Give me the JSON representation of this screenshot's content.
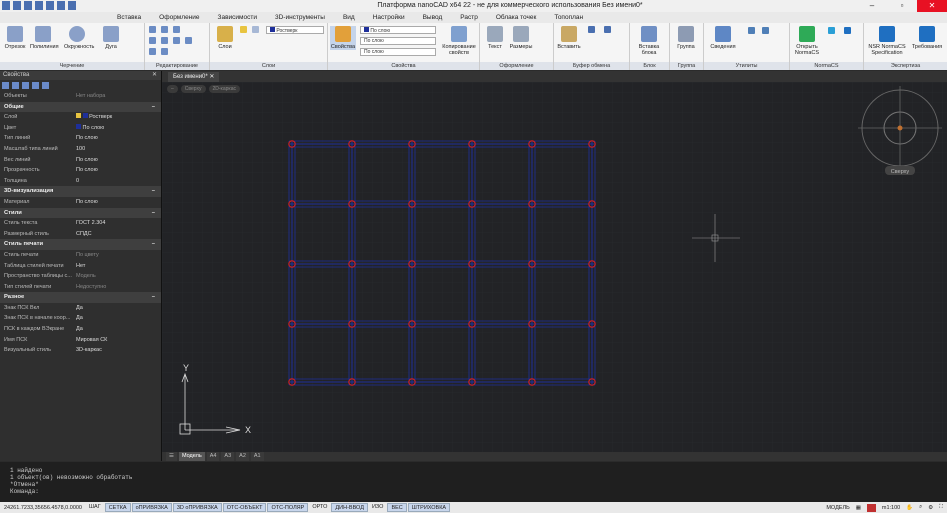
{
  "titlebar": {
    "title": "Платформа nanoCAD x64 22 - не для коммерческого использования Без имени0*"
  },
  "menubar": {
    "items": [
      "Вставка",
      "Оформление",
      "Зависимости",
      "3D-инструменты",
      "Вид",
      "Настройки",
      "Вывод",
      "Растр",
      "Облака точек",
      "Топоплан"
    ]
  },
  "ribbon": {
    "panels": [
      "Черчение",
      "Редактирование",
      "Слои",
      "Свойства",
      "Оформление",
      "Буфер обмена",
      "Блок",
      "Группа",
      "Утилиты",
      "NormaCS",
      "Экспертиза"
    ],
    "draw_buttons": [
      "Отрезок",
      "Полилиния",
      "Окружность",
      "Дуга"
    ],
    "layer_button": "Слои",
    "layer_combo": "Ростверк",
    "props_button": "Свойства",
    "by_layer": "По слою",
    "copy_props": "Копирование свойств",
    "text_button": "Текст",
    "dims_button": "Размеры",
    "paste_button": "Вставить",
    "insert_block": "Вставка блока",
    "group_button": "Группа",
    "info_button": "Сведения",
    "open_normacs": "Открыть NormaCS",
    "nsr": "NSR NormaCS Specification",
    "requirements": "Требования"
  },
  "properties": {
    "header": "Свойства",
    "selection": {
      "k": "Объекты",
      "v": "Нет набора"
    },
    "sections": [
      {
        "title": "Общие",
        "rows": [
          {
            "k": "Слой",
            "v": "Ростверк"
          },
          {
            "k": "Цвет",
            "v": "По слою"
          },
          {
            "k": "Тип линий",
            "v": "По слою"
          },
          {
            "k": "Масштаб типа линий",
            "v": "100"
          },
          {
            "k": "Вес линий",
            "v": "По слою"
          },
          {
            "k": "Прозрачность",
            "v": "По слою"
          },
          {
            "k": "Толщина",
            "v": "0"
          }
        ]
      },
      {
        "title": "3D-визуализация",
        "rows": [
          {
            "k": "Материал",
            "v": "По слою"
          }
        ]
      },
      {
        "title": "Стили",
        "rows": [
          {
            "k": "Стиль текста",
            "v": "ГОСТ 2.304"
          },
          {
            "k": "Размерный стиль",
            "v": "СПДС"
          }
        ]
      },
      {
        "title": "Стиль печати",
        "rows": [
          {
            "k": "Стиль печати",
            "v": "По цвету"
          },
          {
            "k": "Таблица стилей печати",
            "v": "Нет"
          },
          {
            "k": "Пространство таблицы с...",
            "v": "Модель"
          },
          {
            "k": "Тип стилей печати",
            "v": "Недоступно"
          }
        ]
      },
      {
        "title": "Разное",
        "rows": [
          {
            "k": "Знак ПСК Вкл",
            "v": "Да"
          },
          {
            "k": "Знак ПСК в начале коор...",
            "v": "Да"
          },
          {
            "k": "ПСК в каждом ВЭкране",
            "v": "Да"
          },
          {
            "k": "Имя ПСК",
            "v": "Мировая СК"
          },
          {
            "k": "Визуальный стиль",
            "v": "3D-каркас"
          }
        ]
      }
    ]
  },
  "document": {
    "tab": "Без имени0*",
    "view_controls": [
      "–",
      "Сверху",
      "2D-каркас"
    ]
  },
  "canvas": {
    "nav_label": "Сверху",
    "ucs_x": "X",
    "ucs_y": "Y"
  },
  "layout_tabs": [
    "Модель",
    "A4",
    "A3",
    "A2",
    "A1"
  ],
  "command_lines": [
    "1 найдено",
    "1 объект(ов) невозможно обработать",
    "*Отмена*",
    "Команда:"
  ],
  "statusbar": {
    "coords": "24261.7233,35656.4578,0.0000",
    "toggles": [
      {
        "label": "ШАГ",
        "on": false
      },
      {
        "label": "СЕТКА",
        "on": true
      },
      {
        "label": "оПРИВЯЗКА",
        "on": true
      },
      {
        "label": "3D оПРИВЯЗКА",
        "on": true
      },
      {
        "label": "ОТС-ОБЪЕКТ",
        "on": true
      },
      {
        "label": "ОТС-ПОЛЯР",
        "on": true
      },
      {
        "label": "ОРТО",
        "on": false
      },
      {
        "label": "ДИН-ВВОД",
        "on": true
      },
      {
        "label": "ИЗО",
        "on": false
      },
      {
        "label": "ВЕС",
        "on": true
      },
      {
        "label": "ШТРИХОВКА",
        "on": true
      }
    ],
    "model": "МОДЕЛЬ",
    "scale": "m1:100"
  },
  "colors": {
    "beam": "#1e2f9a",
    "pile": "#d42020",
    "accent": "#0b57b5"
  }
}
